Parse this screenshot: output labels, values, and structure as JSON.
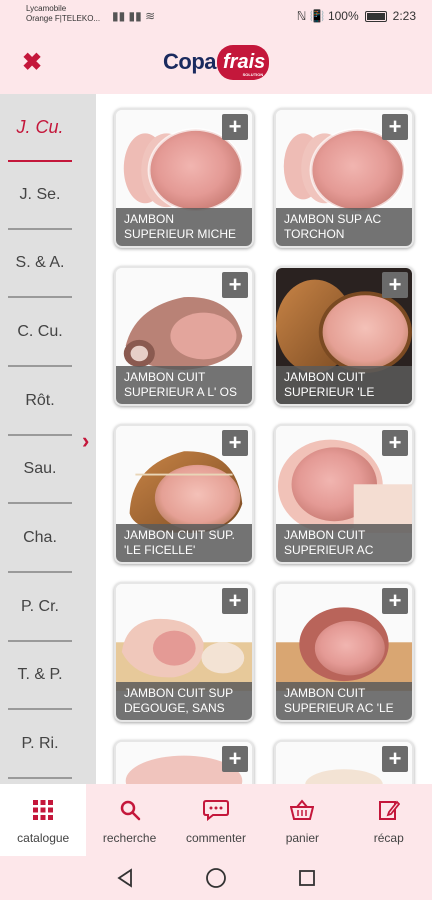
{
  "status_bar": {
    "carrier_line1": "Lycamobile",
    "carrier_line2": "Orange F|TELEKO...",
    "left_icons": "▮▮ ▮▮ ≋",
    "right_text": "ℕ 📳 100%",
    "time": "2:23"
  },
  "header": {
    "logo_part1": "Copa",
    "logo_part2": "frais",
    "logo_sub": "SOLUTION"
  },
  "sidebar": {
    "items": [
      {
        "label": "J. Cu."
      },
      {
        "label": "J. Se."
      },
      {
        "label": "S. & A."
      },
      {
        "label": "C. Cu."
      },
      {
        "label": "Rôt."
      },
      {
        "label": "Sau."
      },
      {
        "label": "Cha."
      },
      {
        "label": "P. Cr."
      },
      {
        "label": "T. & P."
      },
      {
        "label": "P. Ri."
      }
    ],
    "active_index": 0
  },
  "products": [
    {
      "line1": "JAMBON",
      "line2": "SUPERIEUR MICHE"
    },
    {
      "line1": "JAMBON SUP AC",
      "line2": "TORCHON"
    },
    {
      "line1": "JAMBON CUIT",
      "line2": "SUPERIEUR A L' OS"
    },
    {
      "line1": "JAMBON CUIT",
      "line2": "SUPERIEUR 'LE"
    },
    {
      "line1": "JAMBON CUIT SUP.",
      "line2": "'LE FICELLE'"
    },
    {
      "line1": "JAMBON CUIT",
      "line2": "SUPERIEUR AC"
    },
    {
      "line1": "JAMBON CUIT SUP",
      "line2": "DEGOUGE, SANS"
    },
    {
      "line1": "JAMBON CUIT",
      "line2": "SUPERIEUR AC 'LE"
    },
    {
      "line1": "",
      "line2": ""
    },
    {
      "line1": "",
      "line2": ""
    }
  ],
  "add_symbol": "+",
  "bottom_nav": [
    {
      "label": "catalogue",
      "icon": "grid-icon"
    },
    {
      "label": "recherche",
      "icon": "search-icon"
    },
    {
      "label": "commenter",
      "icon": "comment-icon"
    },
    {
      "label": "panier",
      "icon": "basket-icon"
    },
    {
      "label": "récap",
      "icon": "edit-icon"
    }
  ],
  "colors": {
    "accent": "#c4173b",
    "header_bg": "#fde7ea",
    "sidebar_bg": "#e0e0e0"
  }
}
